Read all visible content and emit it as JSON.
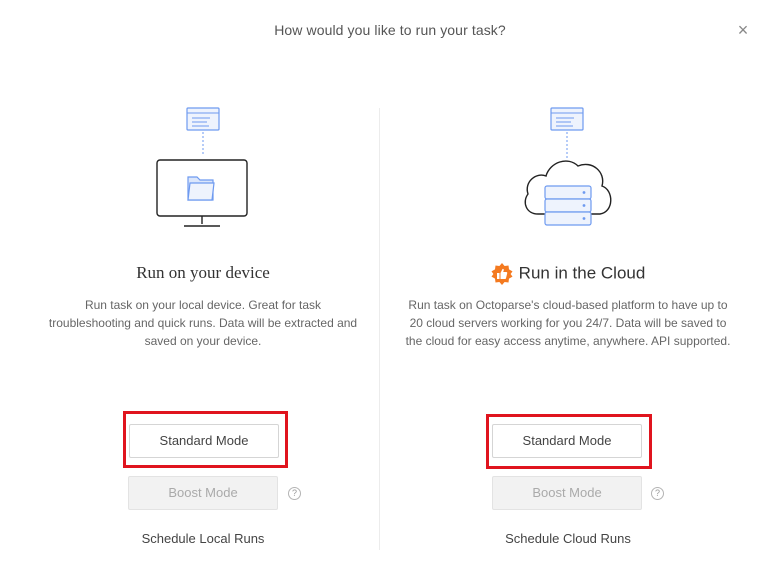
{
  "dialog": {
    "title": "How would you like to run your task?",
    "close_label": "×"
  },
  "local": {
    "title": "Run on your device",
    "description": "Run task on your local device. Great for task troubleshooting and quick runs. Data will be extracted and saved on your device.",
    "standard_label": "Standard Mode",
    "boost_label": "Boost Mode",
    "help_label": "?",
    "schedule_label": "Schedule Local Runs"
  },
  "cloud": {
    "title": "Run in the Cloud",
    "description": "Run task on Octoparse's cloud-based platform to have up to 20 cloud servers working for you 24/7. Data will be saved to the cloud for easy access anytime, anywhere. API supported.",
    "standard_label": "Standard Mode",
    "boost_label": "Boost Mode",
    "help_label": "?",
    "schedule_label": "Schedule Cloud Runs"
  },
  "colors": {
    "highlight": "#e0141e",
    "icon_blue": "#6e9af0",
    "badge_orange": "#f47a20"
  },
  "icons": {
    "local": [
      "browser-window-icon",
      "monitor-icon",
      "folder-icon"
    ],
    "cloud": [
      "browser-window-icon",
      "cloud-icon",
      "server-icon",
      "thumbs-up-badge-icon"
    ]
  }
}
